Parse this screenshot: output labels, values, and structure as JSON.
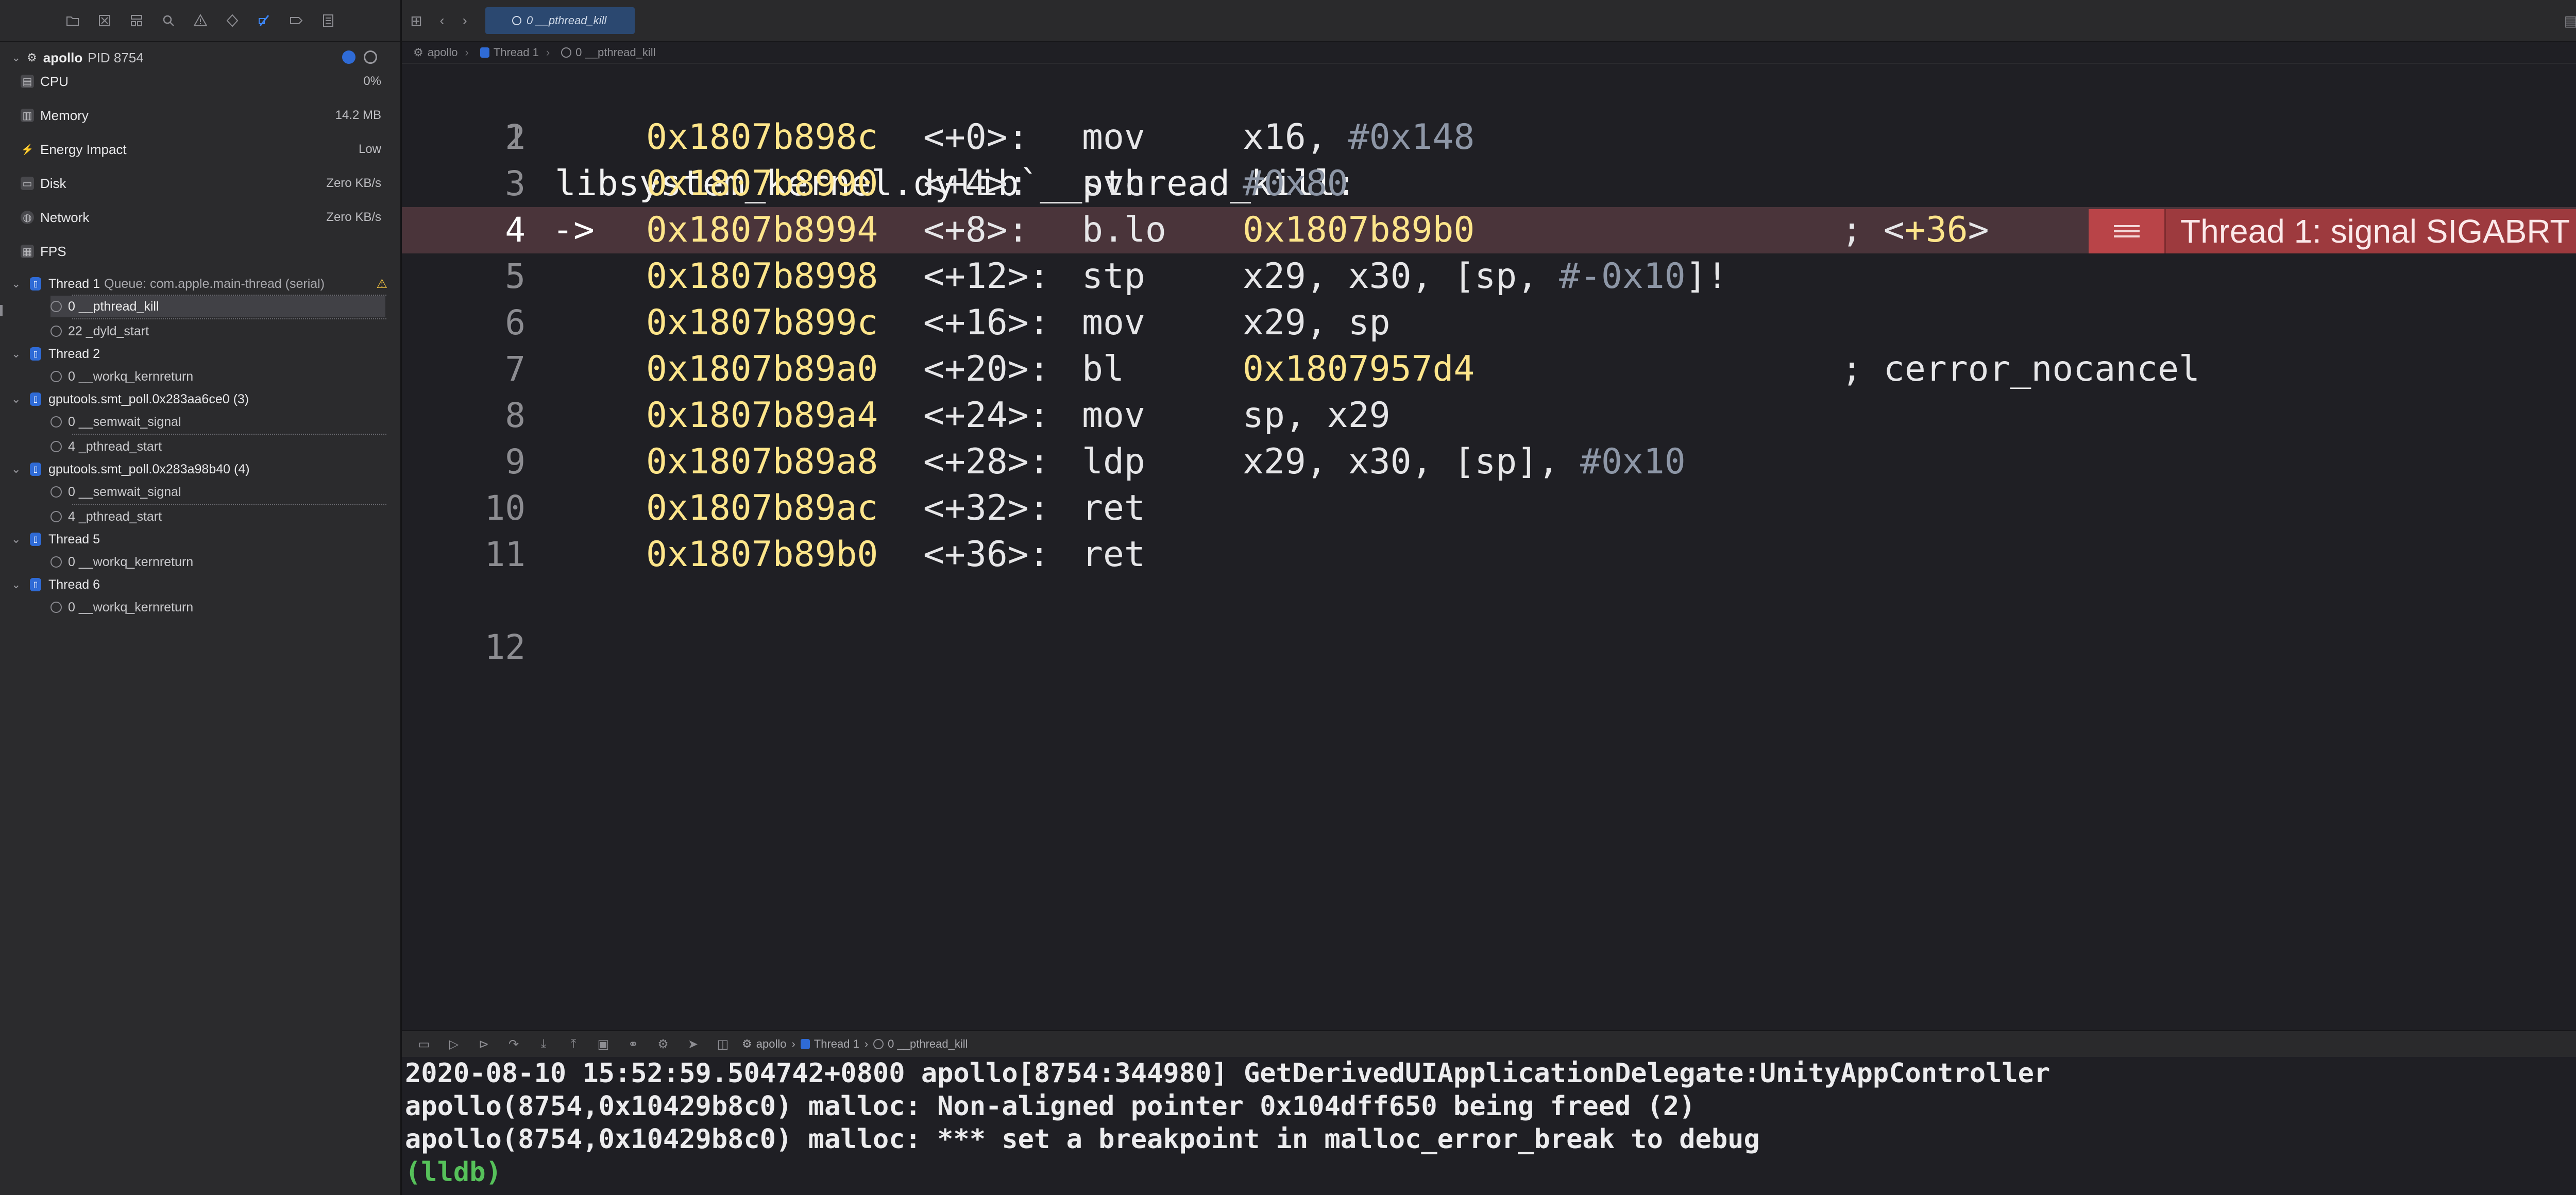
{
  "navigator": {
    "process": {
      "name": "apollo",
      "pid": "PID 8754"
    },
    "gauges": [
      {
        "label": "CPU",
        "value": "0%"
      },
      {
        "label": "Memory",
        "value": "14.2 MB"
      },
      {
        "label": "Energy Impact",
        "value": "Low"
      },
      {
        "label": "Disk",
        "value": "Zero KB/s"
      },
      {
        "label": "Network",
        "value": "Zero KB/s"
      },
      {
        "label": "FPS",
        "value": ""
      }
    ],
    "threads": [
      {
        "name": "Thread 1",
        "queue": "Queue: com.apple.main-thread (serial)",
        "frames": [
          "0 __pthread_kill",
          "22 _dyld_start"
        ]
      },
      {
        "name": "Thread 2",
        "queue": "",
        "frames": [
          "0 __workq_kernreturn"
        ]
      },
      {
        "name": "gputools.smt_poll.0x283aa6ce0 (3)",
        "queue": "",
        "frames": [
          "0 __semwait_signal",
          "4 _pthread_start"
        ]
      },
      {
        "name": "gputools.smt_poll.0x283a98b40 (4)",
        "queue": "",
        "frames": [
          "0 __semwait_signal",
          "4 _pthread_start"
        ]
      },
      {
        "name": "Thread 5",
        "queue": "",
        "frames": [
          "0 __workq_kernreturn"
        ]
      },
      {
        "name": "Thread 6",
        "queue": "",
        "frames": [
          "0 __workq_kernreturn"
        ]
      }
    ]
  },
  "editor": {
    "tab_label": "0 __pthread_kill",
    "jumpbar": {
      "project": "apollo",
      "thread": "Thread 1",
      "frame": "0 __pthread_kill"
    },
    "title_line": "libsystem_kernel.dylib`__pthread_kill:",
    "lines": [
      {
        "num": "1"
      },
      {
        "num": "2",
        "arrow": "",
        "addr": "0x1807b898c",
        "off": "<+0>:",
        "mn": "mov",
        "ops_pre": "x16, ",
        "ops_imm": "#0x148",
        "ops_tgt": "",
        "ops_post": "",
        "cmt_pre": "",
        "cmt_num": "",
        "cmt_name": ""
      },
      {
        "num": "3",
        "arrow": "",
        "addr": "0x1807b8990",
        "off": "<+4>:",
        "mn": "svc",
        "ops_pre": "",
        "ops_imm": "#0x80",
        "ops_tgt": "",
        "ops_post": "",
        "cmt_pre": "",
        "cmt_num": "",
        "cmt_name": ""
      },
      {
        "num": "4",
        "arrow": "->",
        "addr": "0x1807b8994",
        "off": "<+8>:",
        "mn": "b.lo",
        "ops_pre": "",
        "ops_imm": "",
        "ops_tgt": "0x1807b89b0",
        "ops_post": "",
        "cmt_pre": "; <",
        "cmt_num": "+36",
        "cmt_name": ">"
      },
      {
        "num": "5",
        "arrow": "",
        "addr": "0x1807b8998",
        "off": "<+12>:",
        "mn": "stp",
        "ops_pre": "x29, x30, [sp, ",
        "ops_imm": "#-0x10",
        "ops_tgt": "",
        "ops_post": "]!",
        "cmt_pre": "",
        "cmt_num": "",
        "cmt_name": ""
      },
      {
        "num": "6",
        "arrow": "",
        "addr": "0x1807b899c",
        "off": "<+16>:",
        "mn": "mov",
        "ops_pre": "x29, sp",
        "ops_imm": "",
        "ops_tgt": "",
        "ops_post": "",
        "cmt_pre": "",
        "cmt_num": "",
        "cmt_name": ""
      },
      {
        "num": "7",
        "arrow": "",
        "addr": "0x1807b89a0",
        "off": "<+20>:",
        "mn": "bl",
        "ops_pre": "",
        "ops_imm": "",
        "ops_tgt": "0x1807957d4",
        "ops_post": "",
        "cmt_pre": "; cerror_nocancel",
        "cmt_num": "",
        "cmt_name": ""
      },
      {
        "num": "8",
        "arrow": "",
        "addr": "0x1807b89a4",
        "off": "<+24>:",
        "mn": "mov",
        "ops_pre": "sp, x29",
        "ops_imm": "",
        "ops_tgt": "",
        "ops_post": "",
        "cmt_pre": "",
        "cmt_num": "",
        "cmt_name": ""
      },
      {
        "num": "9",
        "arrow": "",
        "addr": "0x1807b89a8",
        "off": "<+28>:",
        "mn": "ldp",
        "ops_pre": "x29, x30, [sp], ",
        "ops_imm": "#0x10",
        "ops_tgt": "",
        "ops_post": "",
        "cmt_pre": "",
        "cmt_num": "",
        "cmt_name": ""
      },
      {
        "num": "10",
        "arrow": "",
        "addr": "0x1807b89ac",
        "off": "<+32>:",
        "mn": "ret",
        "ops_pre": "",
        "ops_imm": "",
        "ops_tgt": "",
        "ops_post": "",
        "cmt_pre": "",
        "cmt_num": "",
        "cmt_name": ""
      },
      {
        "num": "11",
        "arrow": "",
        "addr": "0x1807b89b0",
        "off": "<+36>:",
        "mn": "ret",
        "ops_pre": "",
        "ops_imm": "",
        "ops_tgt": "",
        "ops_post": "",
        "cmt_pre": "",
        "cmt_num": "",
        "cmt_name": ""
      },
      {
        "num": "12"
      }
    ],
    "banner": {
      "text": "Thread 1: signal SIGABRT",
      "color": "#9d3a3e"
    }
  },
  "debug": {
    "crumbs": {
      "project": "apollo",
      "thread": "Thread 1",
      "frame": "0 __pthread_kill"
    },
    "console": [
      "2020-08-10 15:52:59.504742+0800 apollo[8754:344980] GetDerivedUIApplicationDelegate:UnityAppController",
      "apollo(8754,0x10429b8c0) malloc: Non-aligned pointer 0x104dff650 being freed (2)",
      "apollo(8754,0x10429b8c0) malloc: *** set a breakpoint in malloc_error_break to debug",
      "(lldb)"
    ]
  },
  "colors": {
    "background": "#1f1f24",
    "address": "#fde58a",
    "current_line": "#4a343a",
    "prompt": "#56c15a"
  },
  "icons": [
    "folder-icon",
    "source-control-icon",
    "hierarchy-icon",
    "search-icon",
    "issue-icon",
    "test-icon",
    "debug-icon",
    "breakpoint-icon",
    "report-icon"
  ]
}
